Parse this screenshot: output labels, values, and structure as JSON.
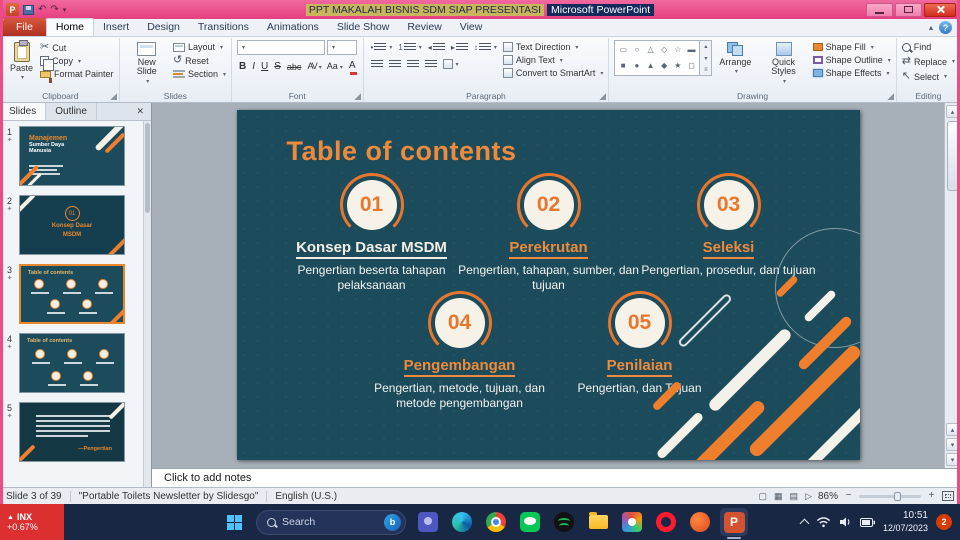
{
  "window": {
    "doc": "PPT MAKALAH BISNIS SDM SIAP PRESENTASI",
    "app": "Microsoft PowerPoint",
    "app_letter": "P"
  },
  "icons": {
    "undo": "↶",
    "redo": "↷",
    "qat_caret": "▾",
    "reset": "↺",
    "replace": "⇄",
    "select": "↖",
    "scissors": "✂",
    "bullet": "•",
    "number": "1",
    "outdent": "◂",
    "indent": "▸",
    "spacing": "↕",
    "scroll_up": "▴",
    "scroll_down": "▾",
    "more": "≡",
    "arrow_up": "▲",
    "arrow_down": "▼",
    "stock_up": "▲",
    "close_panel": "✕",
    "min_ribbon": "▴"
  },
  "ribbon": {
    "file": "File",
    "help": "?",
    "tabs": [
      "Home",
      "Insert",
      "Design",
      "Transitions",
      "Animations",
      "Slide Show",
      "Review",
      "View"
    ],
    "groups": {
      "clipboard": {
        "label": "Clipboard",
        "paste": "Paste",
        "cut": "Cut",
        "copy": "Copy",
        "format_painter": "Format Painter"
      },
      "slides": {
        "label": "Slides",
        "new_slide": "New Slide",
        "layout": "Layout",
        "reset": "Reset",
        "section": "Section"
      },
      "font": {
        "label": "Font",
        "font_name": "",
        "font_size": "",
        "buttons": [
          "B",
          "I",
          "U",
          "S",
          "abc",
          "AV",
          "Aa",
          "A"
        ]
      },
      "paragraph": {
        "label": "Paragraph",
        "text_direction": "Text Direction",
        "align_text": "Align Text",
        "smartart": "Convert to SmartArt"
      },
      "drawing": {
        "label": "Drawing",
        "arrange": "Arrange",
        "quick_styles": "Quick Styles",
        "fill": "Shape Fill",
        "outline": "Shape Outline",
        "effects": "Shape Effects",
        "shapes": [
          "▭",
          "○",
          "△",
          "◇",
          "☆",
          "▬",
          "■",
          "●",
          "▲",
          "◆",
          "★",
          "◻"
        ]
      },
      "editing": {
        "label": "Editing",
        "find": "Find",
        "replace": "Replace",
        "select": "Select"
      }
    }
  },
  "panel": {
    "tab_slides": "Slides",
    "tab_outline": "Outline",
    "star": "✦",
    "thumbs": [
      {
        "num": "1",
        "a": "Manajemen",
        "b": "Sumber Daya",
        "c": "Manusia"
      },
      {
        "num": "2",
        "badge": "01",
        "a": "Konsep Dasar",
        "b": "MSDM"
      },
      {
        "num": "3",
        "a": "Table of contents"
      },
      {
        "num": "4",
        "a": "Table of contents"
      },
      {
        "num": "5",
        "a": "—Pengertian"
      }
    ]
  },
  "slide": {
    "title": "Table of contents",
    "items": [
      {
        "num": "01",
        "heading": "Konsep Dasar MSDM",
        "desc": "Pengertian beserta tahapan pelaksanaan"
      },
      {
        "num": "02",
        "heading": "Perekrutan",
        "desc": "Pengertian, tahapan, sumber, dan tujuan"
      },
      {
        "num": "03",
        "heading": "Seleksi",
        "desc": "Pengertian, prosedur, dan tujuan"
      },
      {
        "num": "04",
        "heading": "Pengembangan",
        "desc": "Pengertian, metode, tujuan, dan metode pengembangan"
      },
      {
        "num": "05",
        "heading": "Penilaian",
        "desc": "Pengertian, dan Tujuan"
      }
    ]
  },
  "notes": {
    "placeholder": "Click to add notes"
  },
  "status": {
    "slide_info": "Slide 3 of 39",
    "theme": "\"Portable Toilets Newsletter by Slidesgo\"",
    "language": "English (U.S.)",
    "zoom": "86%",
    "views": [
      "▢",
      "▦",
      "▤",
      "▷"
    ]
  },
  "taskbar": {
    "stock_symbol": "INX",
    "stock_change": "+0.67%",
    "search_placeholder": "Search",
    "bing": "b",
    "pp": "P",
    "time": "10:51",
    "date": "12/07/2023",
    "notification_count": "2"
  },
  "colors": {
    "accent_orange": "#EE8A3C",
    "slide_teal": "#1C4B5C",
    "titlebar_pink": "#EC4C86",
    "taskbar_navy": "#182743",
    "file_tab_red": "#BE3A27",
    "widget_red": "#DC2F2F"
  }
}
